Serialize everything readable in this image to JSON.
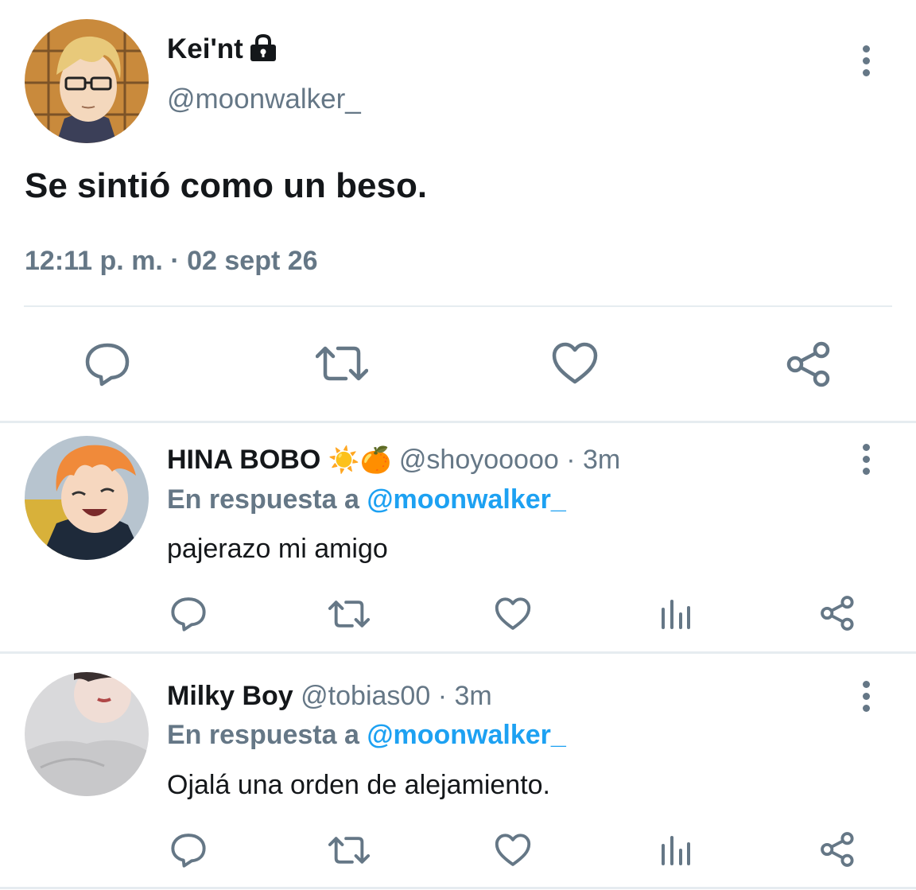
{
  "main_tweet": {
    "display_name": "Kei'nt",
    "handle": "@moonwalker_",
    "text": "Se sintió como un beso.",
    "time": "12:11 p. m.",
    "separator": "·",
    "date": "02 sept 26",
    "lock_icon": "lock-icon"
  },
  "replies": [
    {
      "display_name": "HINA BOBO",
      "emoji": "☀️🍊",
      "handle": "@shoyooooo",
      "age": "· 3m",
      "reply_prefix": "En respuesta a",
      "reply_to": "@moonwalker_",
      "text": "pajerazo mi amigo"
    },
    {
      "display_name": "Milky Boy",
      "handle": "@tobias00",
      "age": "· 3m",
      "reply_prefix": "En respuesta a",
      "reply_to": "@moonwalker_",
      "text": "Ojalá una orden de alejamiento."
    }
  ],
  "icons": {
    "reply": "reply-icon",
    "retweet": "retweet-icon",
    "like": "heart-icon",
    "analytics": "analytics-icon",
    "share": "share-icon",
    "more": "more-vertical-icon"
  },
  "colors": {
    "text": "#14171a",
    "secondary": "#657786",
    "link": "#1da1f2",
    "divider": "#e6ecf0"
  }
}
